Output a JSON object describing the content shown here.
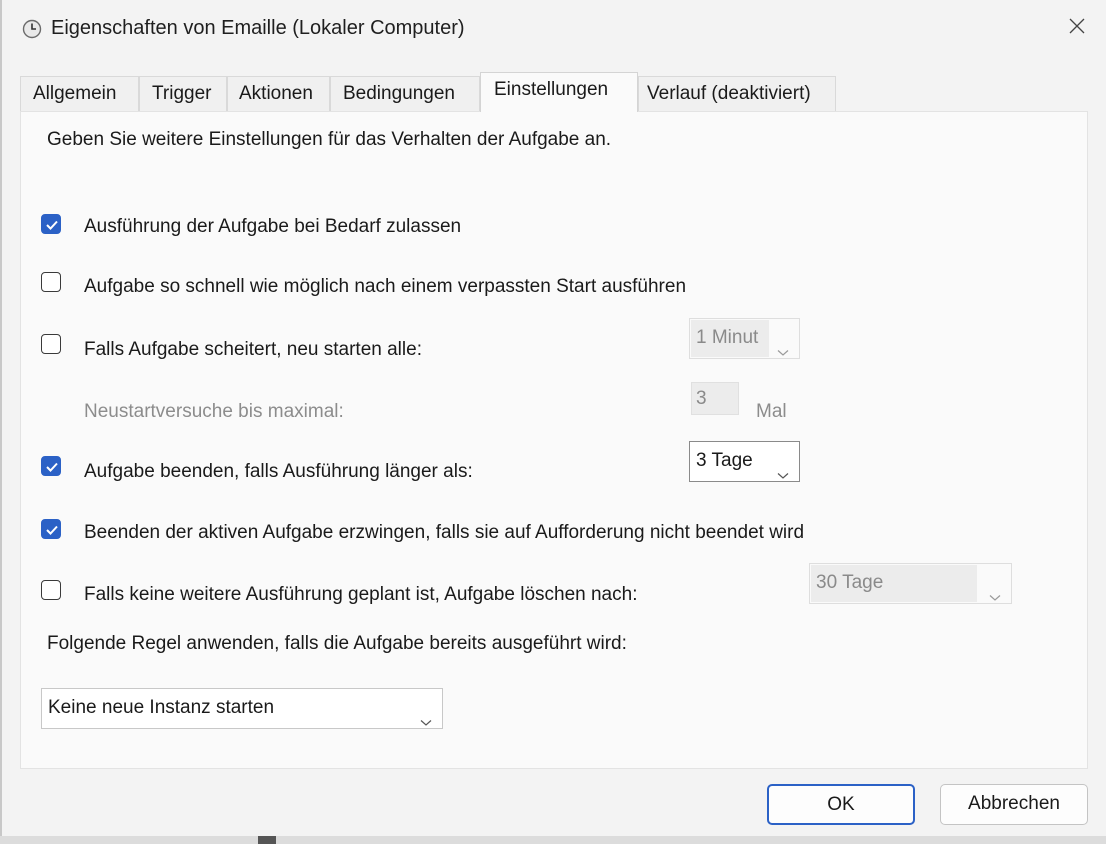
{
  "window": {
    "title": "Eigenschaften von Emaille (Lokaler Computer)",
    "accent_color": "#2b61c6"
  },
  "tabs": [
    {
      "label": "Allgemein",
      "active": false
    },
    {
      "label": "Trigger",
      "active": false
    },
    {
      "label": "Aktionen",
      "active": false
    },
    {
      "label": "Bedingungen",
      "active": false
    },
    {
      "label": "Einstellungen",
      "active": true
    },
    {
      "label": "Verlauf (deaktiviert)",
      "active": false
    }
  ],
  "settings": {
    "intro": "Geben Sie weitere Einstellungen für das Verhalten der Aufgabe an.",
    "allow_on_demand": {
      "label": "Ausführung der Aufgabe bei Bedarf zulassen",
      "checked": true
    },
    "run_after_missed": {
      "label": "Aufgabe so schnell wie möglich nach einem verpassten Start ausführen",
      "checked": false
    },
    "restart_on_failure": {
      "label": "Falls Aufgabe scheitert, neu starten alle:",
      "checked": false,
      "interval": "1 Minut"
    },
    "restart_attempts": {
      "label": "Neustartversuche bis maximal:",
      "value": "3",
      "unit": "Mal"
    },
    "stop_if_longer": {
      "label": "Aufgabe beenden, falls Ausführung länger als:",
      "checked": true,
      "duration": "3 Tage"
    },
    "force_stop": {
      "label": "Beenden der aktiven Aufgabe erzwingen, falls sie auf Aufforderung nicht beendet wird",
      "checked": true
    },
    "delete_if_not_scheduled": {
      "label": "Falls keine weitere Ausführung geplant ist, Aufgabe löschen nach:",
      "checked": false,
      "duration": "30 Tage"
    },
    "rule_label": "Folgende Regel anwenden, falls die Aufgabe bereits ausgeführt wird:",
    "rule_value": "Keine neue Instanz starten"
  },
  "buttons": {
    "ok": "OK",
    "cancel": "Abbrechen"
  },
  "icons": {
    "title": "clock-icon",
    "close": "close-icon",
    "dropdown": "chevron-down-icon",
    "check": "checkmark-icon"
  }
}
